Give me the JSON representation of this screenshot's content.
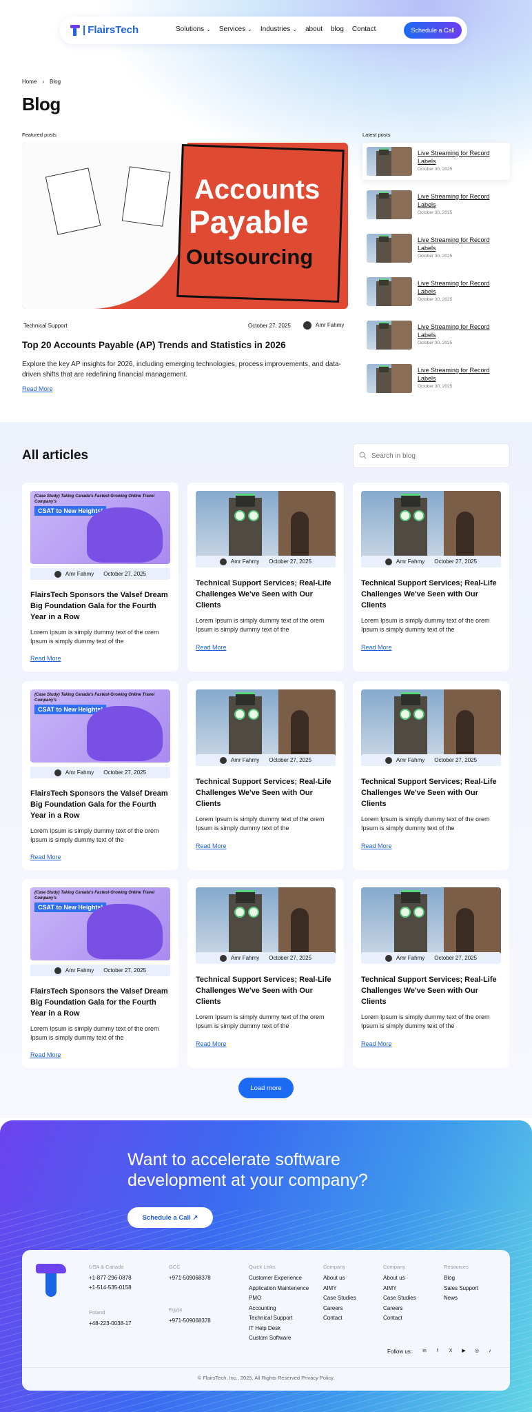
{
  "brand": {
    "name": "FlairsTech"
  },
  "nav": {
    "items": [
      "Solutions",
      "Services",
      "Industries",
      "about",
      "blog",
      "Contact"
    ],
    "cta": "Schedule a Call"
  },
  "breadcrumb": {
    "home": "Home",
    "current": "Blog"
  },
  "page": {
    "title": "Blog"
  },
  "featured": {
    "section": "Featured posts",
    "hero": {
      "l1": "Accounts",
      "l2": "Payable",
      "l3": "Outsourcing"
    },
    "category": "Technical Support",
    "date": "October 27, 2025",
    "author": "Amr Fahmy",
    "title": "Top 20 Accounts Payable (AP) Trends and Statistics in 2026",
    "desc": "Explore the key AP insights for 2026, including emerging technologies, process improvements, and data-driven shifts that are redefining financial management.",
    "read_more": "Read More"
  },
  "latest": {
    "section": "Latest posts",
    "items": [
      {
        "title": "Live Streaming for Record Labels",
        "date": "October 30, 2025"
      },
      {
        "title": "Live Streaming for Record Labels",
        "date": "October 30, 2025"
      },
      {
        "title": "Live Streaming for Record Labels",
        "date": "October 30, 2025"
      },
      {
        "title": "Live Streaming for Record Labels",
        "date": "October 30, 2025"
      },
      {
        "title": "Live Streaming for Record Labels",
        "date": "October 30, 2025"
      },
      {
        "title": "Live Streaming for Record Labels",
        "date": "October 30, 2025"
      }
    ]
  },
  "articles": {
    "title": "All articles",
    "search_placeholder": "Search in blog",
    "case_top": "(Case Study) Taking Canada's Fastest-Growing Online Travel Company's",
    "case_banner": "CSAT to New Heights!",
    "load_more": "Load more",
    "cards": [
      {
        "title": "FlairsTech Sponsors the Valsef Dream Big Foundation Gala for the Fourth Year in a Row",
        "author": "Amr Fahmy",
        "date": "October 27, 2025",
        "desc": "Lorem Ipsum is simply dummy text of the orem Ipsum is simply dummy text of the",
        "read_more": "Read More"
      },
      {
        "title": "Technical Support Services; Real-Life Challenges We've Seen with Our Clients",
        "author": "Amr Fahmy",
        "date": "October 27, 2025",
        "desc": "Lorem Ipsum is simply dummy text of the orem Ipsum is simply dummy text of the",
        "read_more": "Read More"
      },
      {
        "title": "Technical Support Services; Real-Life Challenges We've Seen with Our Clients",
        "author": "Amr Fahmy",
        "date": "October 27, 2025",
        "desc": "Lorem Ipsum is simply dummy text of the orem Ipsum is simply dummy text of the",
        "read_more": "Read More"
      },
      {
        "title": "FlairsTech Sponsors the Valsef Dream Big Foundation Gala for the Fourth Year in a Row",
        "author": "Amr Fahmy",
        "date": "October 27, 2025",
        "desc": "Lorem Ipsum is simply dummy text of the orem Ipsum is simply dummy text of the",
        "read_more": "Read More"
      },
      {
        "title": "Technical Support Services; Real-Life Challenges We've Seen with Our Clients",
        "author": "Amr Fahmy",
        "date": "October 27, 2025",
        "desc": "Lorem Ipsum is simply dummy text of the orem Ipsum is simply dummy text of the",
        "read_more": "Read More"
      },
      {
        "title": "Technical Support Services; Real-Life Challenges We've Seen with Our Clients",
        "author": "Amr Fahmy",
        "date": "October 27, 2025",
        "desc": "Lorem Ipsum is simply dummy text of the orem Ipsum is simply dummy text of the",
        "read_more": "Read More"
      },
      {
        "title": "FlairsTech Sponsors the Valsef Dream Big Foundation Gala for the Fourth Year in a Row",
        "author": "Amr Fahmy",
        "date": "October 27, 2025",
        "desc": "Lorem Ipsum is simply dummy text of the orem Ipsum is simply dummy text of the",
        "read_more": "Read More"
      },
      {
        "title": "Technical Support Services; Real-Life Challenges We've Seen with Our Clients",
        "author": "Amr Fahmy",
        "date": "October 27, 2025",
        "desc": "Lorem Ipsum is simply dummy text of the orem Ipsum is simply dummy text of the",
        "read_more": "Read More"
      },
      {
        "title": "Technical Support Services; Real-Life Challenges We've Seen with Our Clients",
        "author": "Amr Fahmy",
        "date": "October 27, 2025",
        "desc": "Lorem Ipsum is simply dummy text of the orem Ipsum is simply dummy text of the",
        "read_more": "Read More"
      }
    ]
  },
  "footer": {
    "headline": "Want to accelerate software development at your company?",
    "cta": "Schedule a Call",
    "usa_label": "USA & Canada",
    "usa_1": "+1-877-296-0878",
    "usa_2": "+1-514-535-0158",
    "gcc_label": "GCC",
    "gcc_1": "+971-509068378",
    "poland_label": "Poland",
    "poland_1": "+48-223-0038-17",
    "egypt_label": "Egypt",
    "egypt_1": "+971-509068378",
    "quick_label": "Quick Links",
    "quick": [
      "Customer Experience",
      "Application Maintenence",
      "PMO",
      "Accounting",
      "Technical Support",
      "IT Help Desk",
      "Custom Software"
    ],
    "company_label": "Company",
    "company": [
      "About us",
      "AIMY",
      "Case Studies",
      "Careers",
      "Contact"
    ],
    "company2_label": "Company",
    "company2": [
      "About us",
      "AIMY",
      "Case Studies",
      "Careers",
      "Contact"
    ],
    "resources_label": "Resources",
    "resources": [
      "Blog",
      "Sales Support",
      "News"
    ],
    "follow": "Follow us:",
    "social": [
      "in",
      "f",
      "X",
      "▶",
      "◎",
      "♪"
    ],
    "copyright": "© FlairsTech, Inc., 2025. All Rights Reserved Privacy Policy."
  },
  "colors": {
    "primary": "#1d6bf3",
    "accent": "#6b3ff0"
  }
}
